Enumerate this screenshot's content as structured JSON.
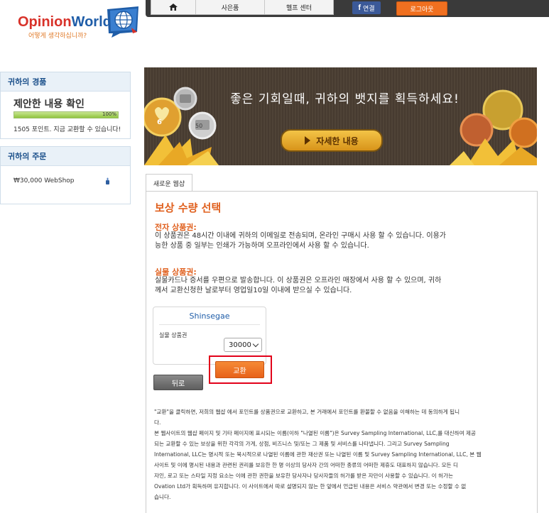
{
  "header": {
    "logo_main": "Opinion",
    "logo_second": "World",
    "tagline": "어떻게 생각하십니까?",
    "nav": {
      "home_icon": "home-icon",
      "gifts": "사은품",
      "help": "헬프 센터",
      "facebook_letter": "f",
      "facebook_label": "연결",
      "logout": "로그아웃"
    }
  },
  "sidebar": {
    "experience": {
      "heading": "귀하의 경품",
      "title": "제안한 내용 확인",
      "progress_percent": 100,
      "progress_label": "100%",
      "note": "1505 포인트. 지금 교환할 수 있습니다!"
    },
    "orders": {
      "heading": "귀하의 주문",
      "item": "₩30,000  WebShop",
      "icon": "thumbs-up-icon"
    }
  },
  "banner": {
    "text": "좋은 기회일때, 귀하의 뱃지를 획득하세요!",
    "button": "자세한 내용",
    "badge_values": [
      "6",
      "50"
    ]
  },
  "tabs": [
    {
      "label": "새로운 웹샵"
    }
  ],
  "main": {
    "title": "보상 수량 선택",
    "electronic": {
      "heading": "전자 상품권:",
      "line1": "이 상품권은 48시간 이내에 귀하의 이메일로 전송되며, 온라인 구매시 사용 할 수 있습니다. 이용가",
      "line2": "능한 상품 중 일부는 인쇄가 가능하며 오프라인에서 사용 할 수 있습니다."
    },
    "physical": {
      "heading": "실물 상품권:",
      "line1": "실물카드나 증서를 우편으로 발송합니다. 이 상품권은 오프라인 매장에서 사용 할 수 있으며, 귀하",
      "line2": "께서 교환신청한 날로부터 영업일10일 이내에 받으실 수 있습니다."
    },
    "card": {
      "brand": "Shinsegae",
      "label": "실물 상품권",
      "selected_value": "30000"
    },
    "exchange_button": "교환",
    "back_button": "뒤로",
    "fine_print": [
      "\"교환\"을 클릭하면, 저희의 웹샵 에서 포인트를 상품권으로 교환하고, 본 거래에서 포인트를 환불할 수 없음을 이해하는 데 동의하게 됩니",
      "다.",
      "본 웹사이트의 웹샵 페이지 및 기타 페이지에 표시되는 이름(이하 \"나열된 이름\")은 Survey Sampling International, LLC,를 대신하여 제공",
      "되는 교환할 수 있는 보상을 위한 각각의 가게, 상점, 비즈니스 및/또는 그 제품 및 서비스를 나타냅니다. 그리고 Survey Sampling",
      "International, LLC는 명시적 또는 묵시적으로 나열된 이름에 관한 재산권 또는 나열된 이름 및 Survey Sampling International, LLC, 본 웹",
      "사이트 및 이에 명시된 내용과 관련된 권리를 보유한 한 명 이상의 당사자 간의 어떠한 종류의 어떠한 제휴도 대표하지 않습니다. 모든 디",
      "자인, 로고 또는 스타일 지정 요소는 이에 관한 권한을 보유한 당사자나 당사자들의 허가를 받은 자만이 사용할 수 있습니다. 이 허가는",
      "Ovation Ltd가 획득하며 유지합니다. 이 사이트에서 따로 설명되지 않는 한 앞에서 언급된 내용은 서비스 약관에서 변경 또는 수정할 수 없",
      "습니다."
    ]
  },
  "colors": {
    "accent_orange": "#e0601e",
    "brand_blue": "#1f5da8",
    "highlight_red": "#e2001a",
    "facebook_blue": "#3b5998"
  }
}
